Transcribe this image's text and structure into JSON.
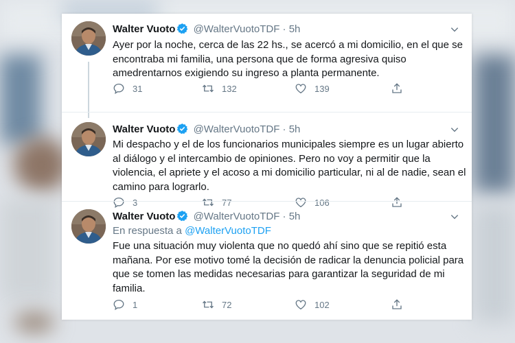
{
  "colors": {
    "accent": "#1da1f2",
    "text": "#14171a",
    "muted": "#657786",
    "verified": "#1da1f2"
  },
  "tweets": [
    {
      "name": "Walter Vuoto",
      "handle": "@WalterVuotoTDF",
      "separator": "·",
      "time": "5h",
      "text": "Ayer por la noche, cerca de las 22 hs., se acercó a mi domicilio, en el que se encontraba mi familia, una persona que de forma agresiva quiso amedrentarnos exigiendo su ingreso a planta permanente.",
      "replies": "31",
      "retweets": "132",
      "likes": "139"
    },
    {
      "name": "Walter Vuoto",
      "handle": "@WalterVuotoTDF",
      "separator": "·",
      "time": "5h",
      "text": "Mi despacho y el de los funcionarios municipales siempre es un lugar abierto al diálogo y el intercambio de opiniones. Pero no voy a permitir que la violencia, el apriete y el acoso a mi domicilio particular, ni al de nadie, sean el camino para lograrlo.",
      "replies": "3",
      "retweets": "77",
      "likes": "106"
    },
    {
      "name": "Walter Vuoto",
      "handle": "@WalterVuotoTDF",
      "separator": "·",
      "time": "5h",
      "reply_to_prefix": "En respuesta a",
      "reply_to_handle": "@WalterVuotoTDF",
      "text": "Fue una situación muy violenta que no quedó ahí sino que se repitió esta mañana. Por ese motivo tomé la decisión de radicar la denuncia policial para que se tomen las medidas necesarias para garantizar la seguridad de mi familia.",
      "replies": "1",
      "retweets": "72",
      "likes": "102"
    }
  ],
  "icons": [
    "verified-badge-icon",
    "chevron-down-icon",
    "reply-icon",
    "retweet-icon",
    "like-icon",
    "share-icon"
  ]
}
